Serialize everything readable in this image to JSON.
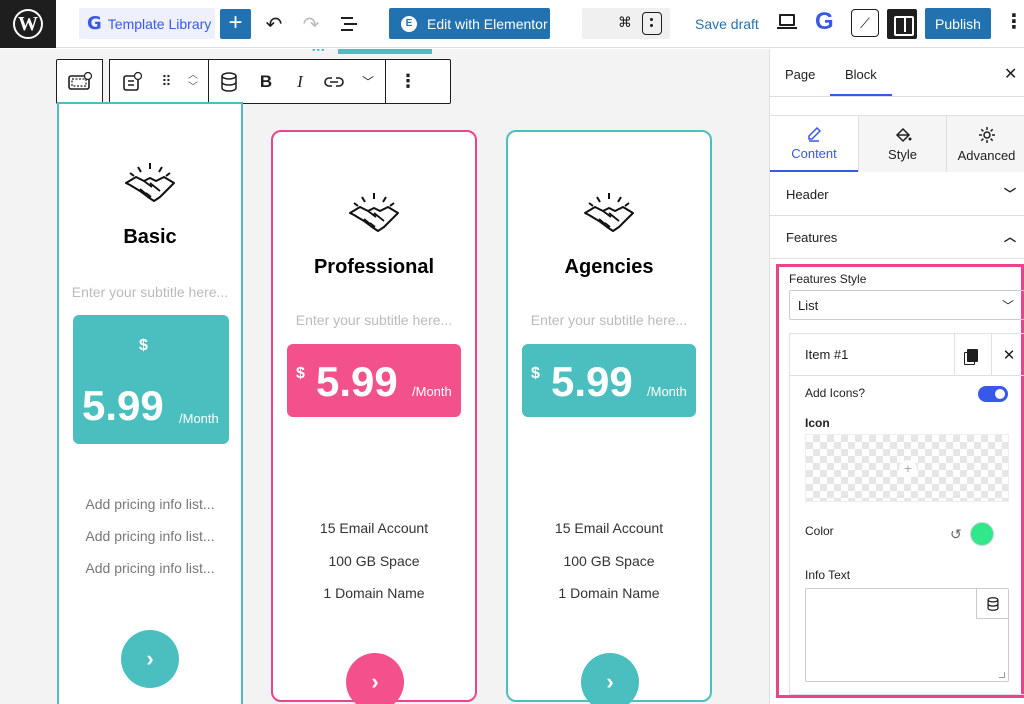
{
  "topbar": {
    "template_library_label": "Template Library",
    "add_label": "+",
    "elementor_label": "Edit with Elementor",
    "shortcut_key": "⌘",
    "save_draft_label": "Save draft",
    "publish_label": "Publish",
    "more_label": "⋮"
  },
  "colors": {
    "accent_blue": "#2271b1",
    "wp_blue": "#3858e9",
    "teal": "#4bbfbf",
    "pink": "#e8458b",
    "green": "#2ee88a"
  },
  "toolbar": {
    "bold_label": "B",
    "italic_label": "I",
    "more_label": "⋮"
  },
  "cards": [
    {
      "title": "Basic",
      "subtitle": "Enter your subtitle here...",
      "currency": "$",
      "price": "5.99",
      "period": "/Month",
      "features": [
        "Add pricing info list...",
        "Add pricing info list...",
        "Add pricing info list..."
      ],
      "cta": "›"
    },
    {
      "title": "Professional",
      "subtitle": "Enter your subtitle here...",
      "currency": "$",
      "price": "5.99",
      "period": "/Month",
      "features": [
        "15 Email Account",
        "100 GB Space",
        "1 Domain Name"
      ],
      "cta": "›"
    },
    {
      "title": "Agencies",
      "subtitle": "Enter your subtitle here...",
      "currency": "$",
      "price": "5.99",
      "period": "/Month",
      "features": [
        "15 Email Account",
        "100 GB Space",
        "1 Domain Name"
      ],
      "cta": "›"
    }
  ],
  "sidebar": {
    "tabs": [
      "Page",
      "Block"
    ],
    "active_tab": "Block",
    "close": "✕",
    "subtabs": [
      {
        "label": "Content",
        "icon": "pencil-icon"
      },
      {
        "label": "Style",
        "icon": "paint-bucket-icon"
      },
      {
        "label": "Advanced",
        "icon": "gear-icon"
      }
    ],
    "sections": [
      {
        "label": "Header",
        "state": "collapsed"
      },
      {
        "label": "Features",
        "state": "expanded"
      }
    ],
    "features": {
      "style_label": "Features Style",
      "style_value": "List",
      "item_title": "Item #1",
      "add_icons_label": "Add Icons?",
      "add_icons_on": true,
      "icon_label": "Icon",
      "color_label": "Color",
      "color_value": "#2ee88a",
      "info_text_label": "Info Text",
      "info_text_value": ""
    }
  }
}
